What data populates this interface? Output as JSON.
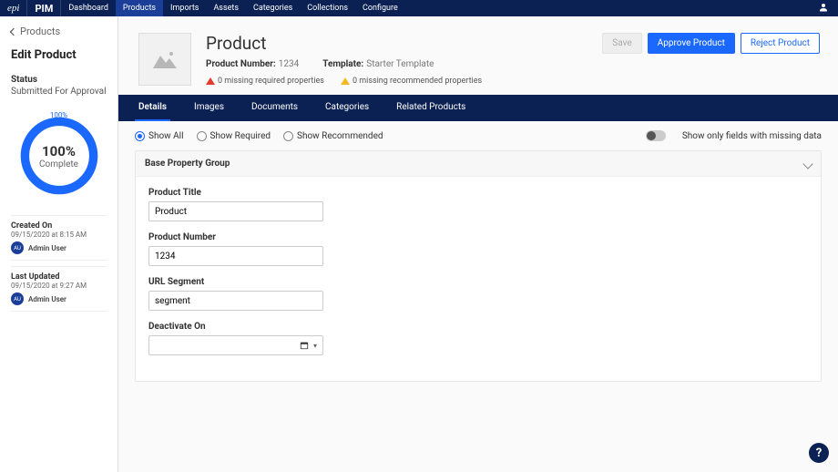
{
  "topnav": {
    "brand_epi": "epi",
    "brand_pim": "PIM",
    "items": [
      "Dashboard",
      "Products",
      "Imports",
      "Assets",
      "Categories",
      "Collections",
      "Configure"
    ],
    "active_index": 1
  },
  "sidebar": {
    "back_label": "Products",
    "edit_title": "Edit Product",
    "status_label": "Status",
    "status_value": "Submitted For Approval",
    "ring": {
      "badge": "100%",
      "percent": "100%",
      "complete_label": "Complete"
    },
    "created": {
      "title": "Created On",
      "date": "09/15/2020 at 8:15 AM",
      "initials": "AU",
      "user": "Admin User"
    },
    "updated": {
      "title": "Last Updated",
      "date": "09/15/2020 at 9:27 AM",
      "initials": "AU",
      "user": "Admin User"
    }
  },
  "product_header": {
    "title": "Product",
    "number_label": "Product Number:",
    "number_value": "1234",
    "template_label": "Template:",
    "template_value": "Starter Template",
    "warn_required": "0 missing required properties",
    "warn_recommended": "0 missing recommended properties",
    "actions": {
      "save": "Save",
      "approve": "Approve Product",
      "reject": "Reject Product"
    }
  },
  "tabs": {
    "items": [
      "Details",
      "Images",
      "Documents",
      "Categories",
      "Related Products"
    ],
    "active_index": 0
  },
  "filters": {
    "show_all": "Show All",
    "show_required": "Show Required",
    "show_recommended": "Show Recommended",
    "missing_only": "Show only fields with missing data"
  },
  "group": {
    "title": "Base Property Group",
    "fields": {
      "title_label": "Product Title",
      "title_value": "Product",
      "number_label": "Product Number",
      "number_value": "1234",
      "url_label": "URL Segment",
      "url_value": "segment",
      "deactivate_label": "Deactivate On",
      "deactivate_value": ""
    }
  },
  "help": "?"
}
